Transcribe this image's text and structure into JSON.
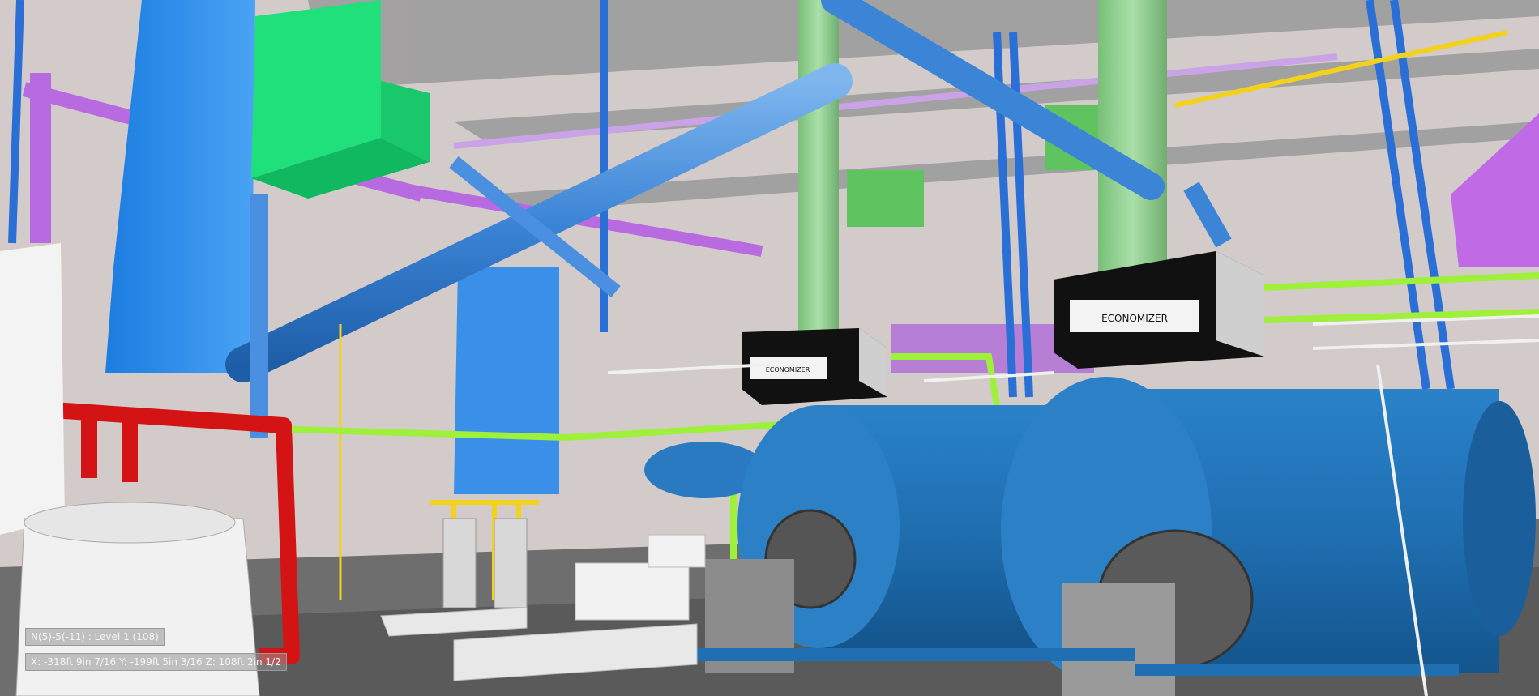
{
  "viewer": {
    "level_readout": "N(5)-5(-11) : Level 1 (108)",
    "coords_readout": "X: -318ft 9in 7/16  Y: -199ft 5in 3/16  Z: 108ft 2in 1/2"
  },
  "equipment_labels": {
    "economizer_large": "ECONOMIZER",
    "economizer_small": "ECONOMIZER"
  },
  "colors": {
    "background": "#cfc6c6",
    "boiler_blue": "#1f6fb2",
    "chilled_pipe_blue": "#3b84d6",
    "duct_blue": "#2f8ee8",
    "ahu_green": "#1fe07a",
    "stack_green": "#8fd08f",
    "gas_yellow": "#f2d21a",
    "steam_red": "#d41414",
    "purple_pipe": "#b86ae0",
    "lime_pipe": "#9ef03a",
    "economizer_black": "#111111"
  }
}
